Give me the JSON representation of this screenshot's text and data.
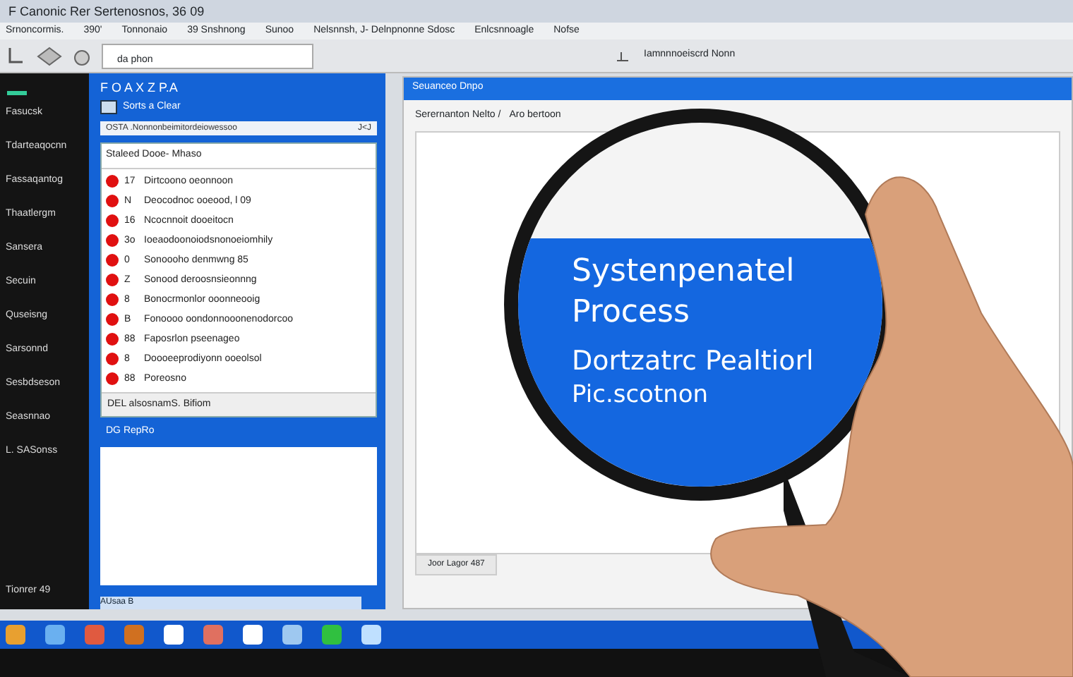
{
  "title_bar": {
    "title": "F Canonic Rer Sertenosnos, 36 09"
  },
  "menu": [
    "Srnoncormis.",
    "390'",
    "Tonnonaio",
    "39 Snshnong",
    "Sunoo",
    "Nelsnnsh, J- Delnpnonne Sdosc",
    "Enlcsnnoagle",
    "Nofse"
  ],
  "toolbar": {
    "field": "da phon",
    "status": "Iamnnnoeiscrd Nonn"
  },
  "sidebar": {
    "items": [
      "Fasucsk",
      "Tdarteaqocnn",
      "Fassaqantog",
      "Thaatlergm",
      "Sansera",
      "Secuin",
      "Quseisng",
      "Sarsonnd",
      "Sesbdseson",
      "Seasnnao",
      "L. SASonss"
    ],
    "footer": "Tionrer 49"
  },
  "panel": {
    "toolbar": "F O A X Z P.A",
    "header": "Sorts a Clear",
    "search": "OSTA .Nonnonbeimitordeiowessoo",
    "search_button": "J<J",
    "list_header": "Staleed Dooe- Mhaso",
    "items": [
      {
        "num": "17",
        "text": "Dirtcoono oeonnoon"
      },
      {
        "num": "N",
        "text": "Deocodnoc ooeood, l 09"
      },
      {
        "num": "16",
        "text": "Ncocnnoit dooeitocn"
      },
      {
        "num": "3o",
        "text": "Ioeaodoonoiodsnonoeiomhily"
      },
      {
        "num": "0",
        "text": "Sonoooho denmwng 85"
      },
      {
        "num": "Z",
        "text": "Sonood deroosnsieonnng"
      },
      {
        "num": "8",
        "text": "Bonocrmonlor ooonneooig"
      },
      {
        "num": "B",
        "text": "Fonoooo oondonnooonenodorcoo"
      },
      {
        "num": "88",
        "text": "Faposrlon pseenageo"
      },
      {
        "num": "8",
        "text": "Doooeeprodiyonn ooeolsol"
      },
      {
        "num": "88",
        "text": "Poreosno"
      }
    ],
    "list_footer": "DEL alsosnamS. Bifiom",
    "section_label": "DG RepRo",
    "status": "AUsaa B"
  },
  "window": {
    "title": "Seuanceo Dnpo",
    "toolbar": [
      "Serernanton Nelto /",
      "Aro bertoon"
    ],
    "tab": "Joor Lagor 487"
  },
  "lens": {
    "lines": [
      "Systenpenatel",
      "Process",
      "Dortzatrc Pealtiorl",
      "Pic.scotnon"
    ]
  }
}
